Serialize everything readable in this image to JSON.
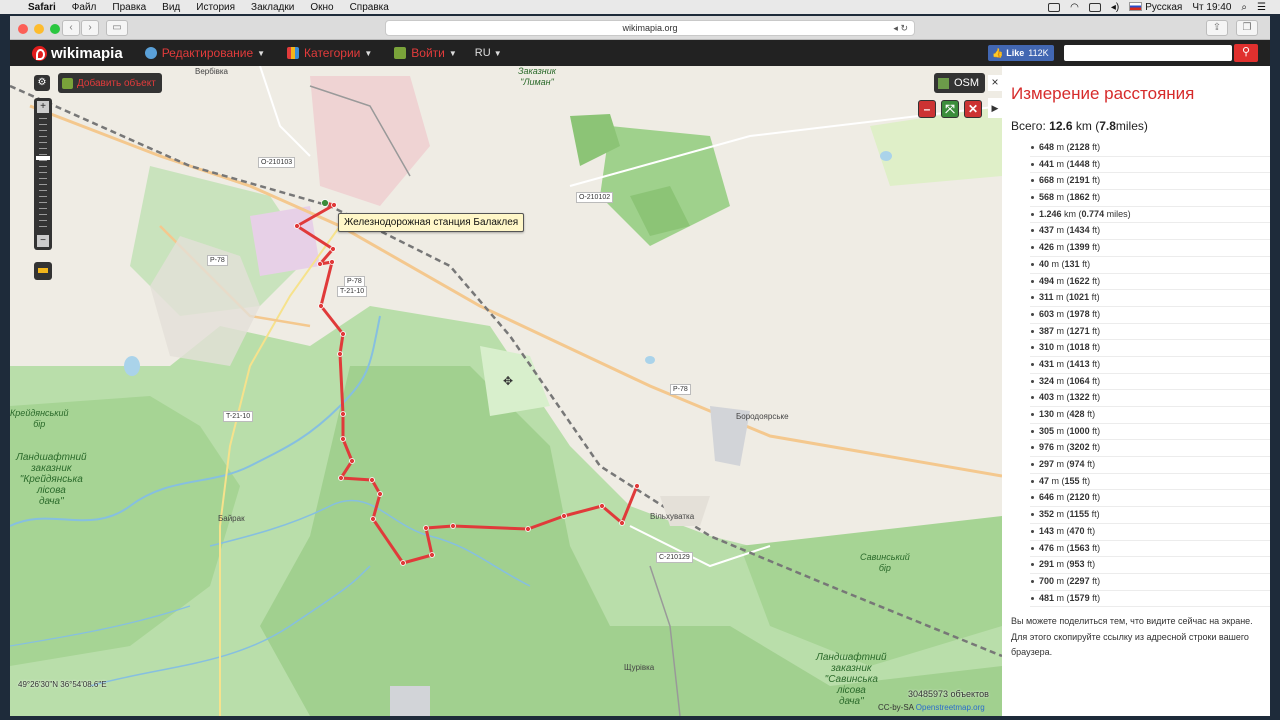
{
  "os_menubar": {
    "app": "Safari",
    "items": [
      "Файл",
      "Правка",
      "Вид",
      "История",
      "Закладки",
      "Окно",
      "Справка"
    ],
    "input_source": "Русская",
    "clock": "Чт 19:40"
  },
  "browser": {
    "url": "wikimapia.org"
  },
  "header": {
    "logo": "wikimapia",
    "menu": [
      {
        "label": "Редактирование"
      },
      {
        "label": "Категории"
      },
      {
        "label": "Войти"
      }
    ],
    "lang": "RU",
    "fb_like": "Like",
    "fb_count": "112K",
    "search_placeholder": ""
  },
  "map": {
    "add_object": "Добавить объект",
    "layer": "OSM",
    "tooltip": "Железнодорожная станция Балаклея",
    "coords": "49°26'30\"N 36°54'08.6\"E",
    "objects_count": "30485973 объектов",
    "attribution_prefix": "CC-by-SA",
    "attribution_link": "Openstreetmap.org",
    "places": {
      "verbivka": "Вербівка",
      "zakaznik_liman": "Заказник\n\"Лиман\"",
      "borodoyarske": "Бородоярське",
      "vilkhuvatka": "Вільхуватка",
      "bayrak": "Байрак",
      "shchurivka": "Щурівка",
      "kreydianskyi_bir": "Крейдянський\nбір",
      "kreydianska_dacha": "Ландшафтний\nзаказник\n\"Крейдянська\nлісова\nдача\"",
      "savynskyi_bir": "Савинський\nбір",
      "savynska_dacha": "Ландшафтний\nзаказник\n\"Савинська\nлісова\nдача\""
    },
    "roads": {
      "o210103": "O-210103",
      "o210102": "O-210102",
      "p78_a": "P-78",
      "p78_b": "P-78",
      "t2110_a": "T-21-10",
      "p78_c": "P-78",
      "t2110_b": "T-21-10",
      "c210129": "C-210129"
    }
  },
  "panel": {
    "title": "Измерение расстояния",
    "total_label": "Всего:",
    "total_value": "12.6",
    "total_unit": "km",
    "total_miles": "7.8",
    "total_miles_unit": "miles",
    "segments": [
      {
        "value": "648",
        "unit": "m",
        "imperial": "2128",
        "iunit": "ft"
      },
      {
        "value": "441",
        "unit": "m",
        "imperial": "1448",
        "iunit": "ft"
      },
      {
        "value": "668",
        "unit": "m",
        "imperial": "2191",
        "iunit": "ft"
      },
      {
        "value": "568",
        "unit": "m",
        "imperial": "1862",
        "iunit": "ft"
      },
      {
        "value": "1.246",
        "unit": "km",
        "imperial": "0.774",
        "iunit": "miles"
      },
      {
        "value": "437",
        "unit": "m",
        "imperial": "1434",
        "iunit": "ft"
      },
      {
        "value": "426",
        "unit": "m",
        "imperial": "1399",
        "iunit": "ft"
      },
      {
        "value": "40",
        "unit": "m",
        "imperial": "131",
        "iunit": "ft"
      },
      {
        "value": "494",
        "unit": "m",
        "imperial": "1622",
        "iunit": "ft"
      },
      {
        "value": "311",
        "unit": "m",
        "imperial": "1021",
        "iunit": "ft"
      },
      {
        "value": "603",
        "unit": "m",
        "imperial": "1978",
        "iunit": "ft"
      },
      {
        "value": "387",
        "unit": "m",
        "imperial": "1271",
        "iunit": "ft"
      },
      {
        "value": "310",
        "unit": "m",
        "imperial": "1018",
        "iunit": "ft"
      },
      {
        "value": "431",
        "unit": "m",
        "imperial": "1413",
        "iunit": "ft"
      },
      {
        "value": "324",
        "unit": "m",
        "imperial": "1064",
        "iunit": "ft"
      },
      {
        "value": "403",
        "unit": "m",
        "imperial": "1322",
        "iunit": "ft"
      },
      {
        "value": "130",
        "unit": "m",
        "imperial": "428",
        "iunit": "ft"
      },
      {
        "value": "305",
        "unit": "m",
        "imperial": "1000",
        "iunit": "ft"
      },
      {
        "value": "976",
        "unit": "m",
        "imperial": "3202",
        "iunit": "ft"
      },
      {
        "value": "297",
        "unit": "m",
        "imperial": "974",
        "iunit": "ft"
      },
      {
        "value": "47",
        "unit": "m",
        "imperial": "155",
        "iunit": "ft"
      },
      {
        "value": "646",
        "unit": "m",
        "imperial": "2120",
        "iunit": "ft"
      },
      {
        "value": "352",
        "unit": "m",
        "imperial": "1155",
        "iunit": "ft"
      },
      {
        "value": "143",
        "unit": "m",
        "imperial": "470",
        "iunit": "ft"
      },
      {
        "value": "476",
        "unit": "m",
        "imperial": "1563",
        "iunit": "ft"
      },
      {
        "value": "291",
        "unit": "m",
        "imperial": "953",
        "iunit": "ft"
      },
      {
        "value": "700",
        "unit": "m",
        "imperial": "2297",
        "iunit": "ft"
      },
      {
        "value": "481",
        "unit": "m",
        "imperial": "1579",
        "iunit": "ft"
      }
    ],
    "share_note": "Вы можете поделиться тем, что видите сейчас на экране. Для этого скопируйте ссылку из адресной строки вашего браузера."
  },
  "colors": {
    "route": "#e03a3a",
    "accent": "#d62b2b",
    "forest": "#a9d69a",
    "water": "#86bfe0"
  }
}
